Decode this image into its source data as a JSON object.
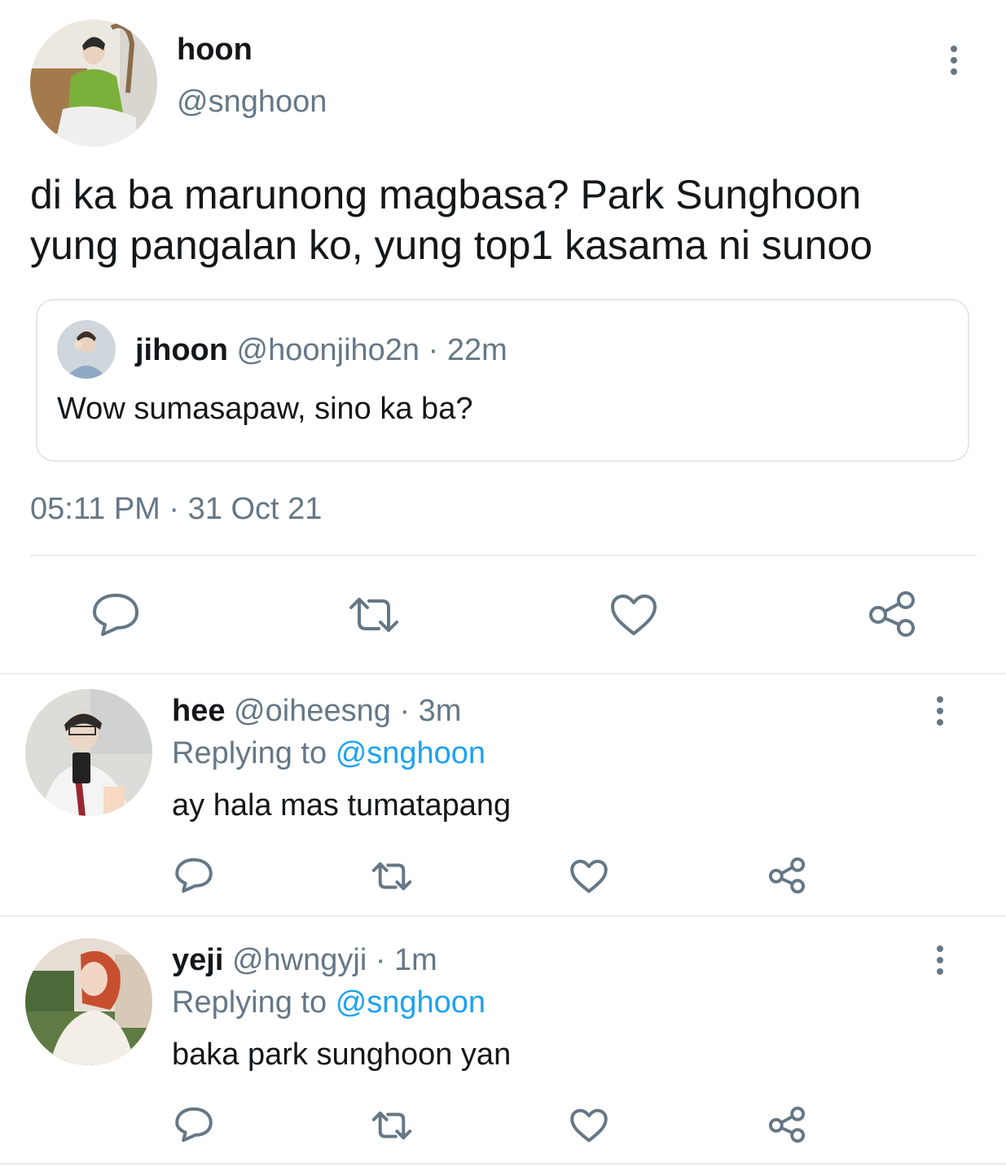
{
  "main_tweet": {
    "display_name": "hoon",
    "handle": "@snghoon",
    "text_line1": "di ka ba marunong magbasa? Park Sunghoon",
    "text_line2": "yung pangalan ko, yung top1 kasama ni sunoo",
    "quoted": {
      "display_name": "jihoon",
      "handle": "@hoonjiho2n",
      "separator": "·",
      "time": "22m",
      "text": "Wow sumasapaw, sino ka ba?"
    },
    "time": "05:11 PM",
    "separator": "·",
    "date": "31 Oct 21",
    "actions": [
      "reply-icon",
      "retweet-icon",
      "like-icon",
      "share-icon"
    ]
  },
  "replies": [
    {
      "display_name": "hee",
      "handle": "@oiheesng",
      "separator": "·",
      "time": "3m",
      "replying_prefix": "Replying to",
      "replying_handle": "@snghoon",
      "text": "ay hala mas tumatapang"
    },
    {
      "display_name": "yeji",
      "handle": "@hwngyji",
      "separator": "·",
      "time": "1m",
      "replying_prefix": "Replying to",
      "replying_handle": "@snghoon",
      "text": "baka park sunghoon yan"
    }
  ],
  "colors": {
    "link": "#1da1f2",
    "muted": "#657786",
    "text": "#14171a",
    "divider": "#e6ecf0"
  }
}
